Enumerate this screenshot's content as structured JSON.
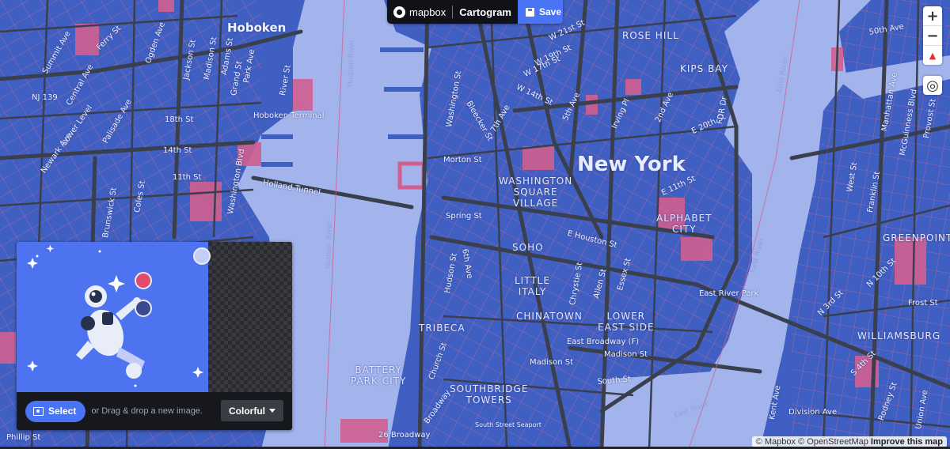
{
  "brand": {
    "provider": "mapbox",
    "app": "Cartogram",
    "save_label": "Save"
  },
  "map": {
    "city": "New York",
    "neighborhoods": [
      {
        "name": "ROSE HILL"
      },
      {
        "name": "KIPS BAY"
      },
      {
        "name": "WASHINGTON\nSQUARE\nVILLAGE"
      },
      {
        "name": "ALPHABET\nCITY"
      },
      {
        "name": "SOHO"
      },
      {
        "name": "LITTLE\nITALY"
      },
      {
        "name": "CHINATOWN"
      },
      {
        "name": "LOWER\nEAST SIDE"
      },
      {
        "name": "TRIBECA"
      },
      {
        "name": "BATTERY\nPARK CITY"
      },
      {
        "name": "SOUTHBRIDGE\nTOWERS"
      },
      {
        "name": "GREENPOINT"
      },
      {
        "name": "WILLIAMSBURG"
      }
    ],
    "places": [
      "Hoboken",
      "Hoboken Terminal",
      "Holland Tunnel",
      "East River Park",
      "Madison St",
      "East Broadway (F)"
    ],
    "streets": [
      "Ferry St",
      "Summit Ave",
      "Central Ave",
      "Jackson St",
      "Madison St",
      "Adams St",
      "Grand St",
      "Park Ave",
      "River St",
      "Ogden Ave",
      "NJ 139",
      "Lower Level",
      "Palisade Ave",
      "Newark Ave",
      "18th St",
      "14th St",
      "11th St",
      "Washington Blvd",
      "Brunswick St",
      "Coles St",
      "W 21st St",
      "W 19th St",
      "W 17th St",
      "W 14th St",
      "5th Ave",
      "Irving Pl",
      "2nd Ave",
      "E 20th St",
      "E 11th St",
      "Bleecker St",
      "7th Ave",
      "Morton St",
      "Spring St",
      "6th Ave",
      "Hudson St",
      "Church St",
      "E Houston St",
      "Chrystie St",
      "Essex St",
      "Allen St",
      "South St",
      "Madison St",
      "Broadway",
      "FDR Dr",
      "Frost St",
      "N 10th St",
      "N 3rd St",
      "S 4th St",
      "Division Ave",
      "Kent Ave",
      "Franklin St",
      "Manhattan Ave",
      "McGuinness Blvd",
      "Provost St",
      "Union Ave",
      "Rodney St",
      "West St",
      "50th Ave",
      "26 Broadway",
      "South Street Seaport",
      "Phillip St",
      "Washington St"
    ],
    "water": [
      "Hudson River",
      "East River"
    ],
    "controls": {
      "zoom_in": "+",
      "zoom_out": "−",
      "compass": "▲",
      "locate": "◎"
    },
    "attribution": {
      "mapbox": "© Mapbox",
      "osm": "© OpenStreetMap",
      "improve": "Improve this map"
    }
  },
  "panel": {
    "select_label": "Select",
    "hint": "or Drag & drop a new image.",
    "style_selected": "Colorful",
    "swatches": [
      "#c3cdf7",
      "#e24a6e",
      "#3a4a8f"
    ],
    "preview_bg": "#4e73f0"
  },
  "colors": {
    "land": "#3f5fc2",
    "water": "#a3b4ec",
    "roads": "#3c4150",
    "parks": "#d05f90",
    "accent": "#4874f5"
  }
}
